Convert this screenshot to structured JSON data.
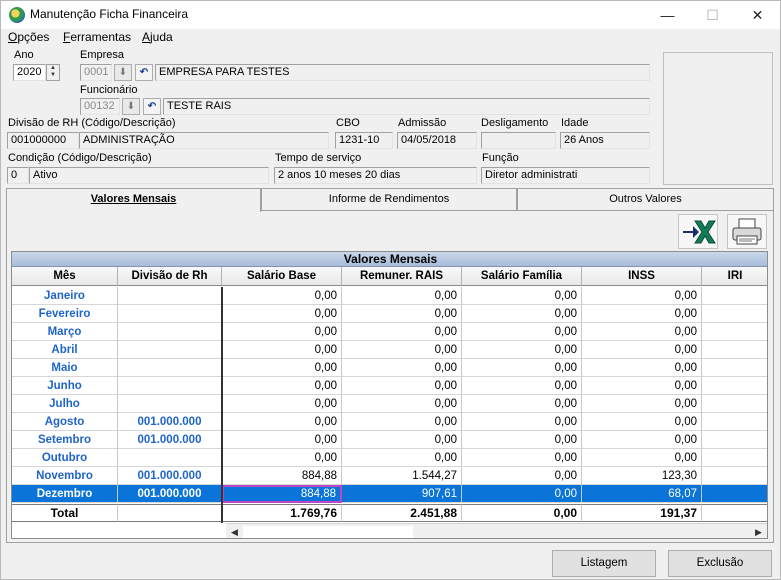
{
  "window": {
    "title": "Manutenção Ficha Financeira",
    "minimize": "—",
    "maximize": "☐",
    "close": "✕"
  },
  "menu": [
    {
      "label": "Opções",
      "u": "O",
      "rest": "pções"
    },
    {
      "label": "Ferramentas",
      "u": "F",
      "rest": "erramentas"
    },
    {
      "label": "Ajuda",
      "u": "A",
      "rest": "juda"
    }
  ],
  "form": {
    "ano_label": "Ano",
    "ano_value": "2020",
    "empresa_label": "Empresa",
    "empresa_code": "0001",
    "empresa_name": "EMPRESA PARA TESTES",
    "funcionario_label": "Funcionário",
    "funcionario_code": "00132",
    "funcionario_name": "TESTE RAIS",
    "divisao_label": "Divisão de RH (Código/Descrição)",
    "divisao_code": "001000000",
    "divisao_desc": "ADMINISTRAÇÃO",
    "cbo_label": "CBO",
    "cbo_value": "1231-10",
    "admissao_label": "Admissão",
    "admissao_value": "04/05/2018",
    "desligamento_label": "Desligamento",
    "desligamento_value": "",
    "idade_label": "Idade",
    "idade_value": "26 Anos",
    "condicao_label": "Condição (Código/Descrição)",
    "condicao_code": "0",
    "condicao_desc": "Ativo",
    "tempo_label": "Tempo de serviço",
    "tempo_value": "2 anos 10 meses 20 dias",
    "funcao_label": "Função",
    "funcao_value": "Diretor administrati"
  },
  "tabs": [
    {
      "label": "Valores Mensais",
      "active": true
    },
    {
      "label": "Informe de Rendimentos",
      "active": false
    },
    {
      "label": "Outros Valores",
      "active": false
    }
  ],
  "toolbar": {
    "excel_icon": "excel-export-icon",
    "print_icon": "printer-icon"
  },
  "grid": {
    "title": "Valores Mensais",
    "columns": [
      "Mês",
      "Divisão de Rh",
      "Salário Base",
      "Remuner. RAIS",
      "Salário Família",
      "INSS",
      "IRI"
    ],
    "rows": [
      {
        "month": "Janeiro",
        "div": "",
        "values": [
          "0,00",
          "0,00",
          "0,00",
          "0,00"
        ]
      },
      {
        "month": "Fevereiro",
        "div": "",
        "values": [
          "0,00",
          "0,00",
          "0,00",
          "0,00"
        ]
      },
      {
        "month": "Março",
        "div": "",
        "values": [
          "0,00",
          "0,00",
          "0,00",
          "0,00"
        ]
      },
      {
        "month": "Abril",
        "div": "",
        "values": [
          "0,00",
          "0,00",
          "0,00",
          "0,00"
        ]
      },
      {
        "month": "Maio",
        "div": "",
        "values": [
          "0,00",
          "0,00",
          "0,00",
          "0,00"
        ]
      },
      {
        "month": "Junho",
        "div": "",
        "values": [
          "0,00",
          "0,00",
          "0,00",
          "0,00"
        ]
      },
      {
        "month": "Julho",
        "div": "",
        "values": [
          "0,00",
          "0,00",
          "0,00",
          "0,00"
        ]
      },
      {
        "month": "Agosto",
        "div": "001.000.000",
        "values": [
          "0,00",
          "0,00",
          "0,00",
          "0,00"
        ]
      },
      {
        "month": "Setembro",
        "div": "001.000.000",
        "values": [
          "0,00",
          "0,00",
          "0,00",
          "0,00"
        ]
      },
      {
        "month": "Outubro",
        "div": "",
        "values": [
          "0,00",
          "0,00",
          "0,00",
          "0,00"
        ]
      },
      {
        "month": "Novembro",
        "div": "001.000.000",
        "values": [
          "884,88",
          "1.544,27",
          "0,00",
          "123,30"
        ]
      },
      {
        "month": "Dezembro",
        "div": "001.000.000",
        "values": [
          "884,88",
          "907,61",
          "0,00",
          "68,07"
        ],
        "selected": true
      }
    ],
    "total": {
      "label": "Total",
      "values": [
        "1.769,76",
        "2.451,88",
        "0,00",
        "191,37"
      ]
    }
  },
  "buttons": {
    "listagem": "Listagem",
    "exclusao": "Exclusão"
  }
}
